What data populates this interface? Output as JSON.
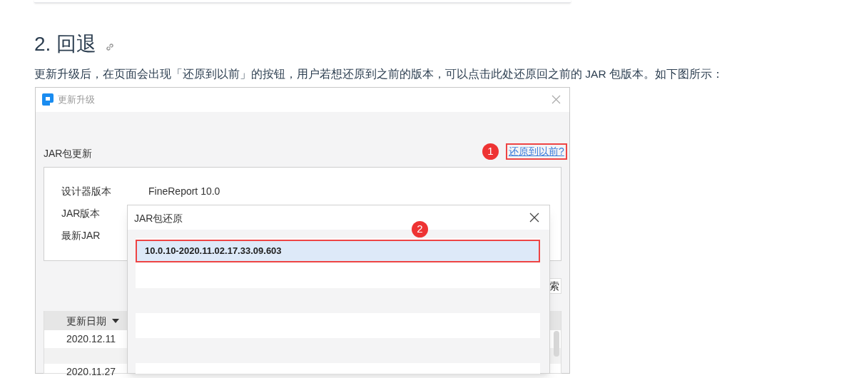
{
  "heading": "2. 回退",
  "paragraph": "更新升级后，在页面会出现「还原到以前」的按钮，用户若想还原到之前的版本，可以点击此处还原回之前的 JAR 包版本。如下图所示：",
  "screenshot": {
    "window": {
      "title": "更新升级",
      "section_title": "JAR包更新",
      "restore_link": "还原到以前?",
      "info": [
        {
          "label": "设计器版本",
          "value": "FineReport 10.0"
        },
        {
          "label": "JAR版本"
        },
        {
          "label": "最新JAR"
        }
      ],
      "button_fragment": "索",
      "table": {
        "columns": [
          {
            "label": "更新日期",
            "sorted": true
          }
        ],
        "rows": [
          "2020.12.11",
          "2020.11.27"
        ]
      }
    },
    "dialog": {
      "title": "JAR包还原",
      "items": [
        {
          "label": "10.0.10-2020.11.02.17.33.09.603",
          "selected": true
        }
      ]
    },
    "callouts": [
      "1",
      "2"
    ]
  }
}
